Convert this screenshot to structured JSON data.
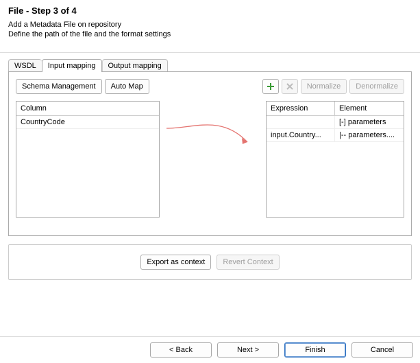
{
  "header": {
    "title": "File - Step 3 of 4",
    "subtitle_line1": "Add a Metadata File on repository",
    "subtitle_line2": "Define the path of the file and the format settings"
  },
  "tabs": {
    "wsdl": "WSDL",
    "input_mapping": "Input mapping",
    "output_mapping": "Output mapping"
  },
  "toolbar": {
    "schema_management": "Schema Management",
    "auto_map": "Auto Map",
    "normalize": "Normalize",
    "denormalize": "Denormalize",
    "add_icon": "add-icon",
    "delete_icon": "delete-icon"
  },
  "left_table": {
    "header": "Column",
    "rows": [
      "CountryCode"
    ]
  },
  "right_table": {
    "headers": {
      "expression": "Expression",
      "element": "Element"
    },
    "rows": [
      {
        "expression": "",
        "element": "[-] parameters"
      },
      {
        "expression": "input.Country...",
        "element": "|-- parameters...."
      }
    ]
  },
  "context_bar": {
    "export": "Export as context",
    "revert": "Revert Context"
  },
  "wizard_buttons": {
    "back": "< Back",
    "next": "Next >",
    "finish": "Finish",
    "cancel": "Cancel"
  }
}
